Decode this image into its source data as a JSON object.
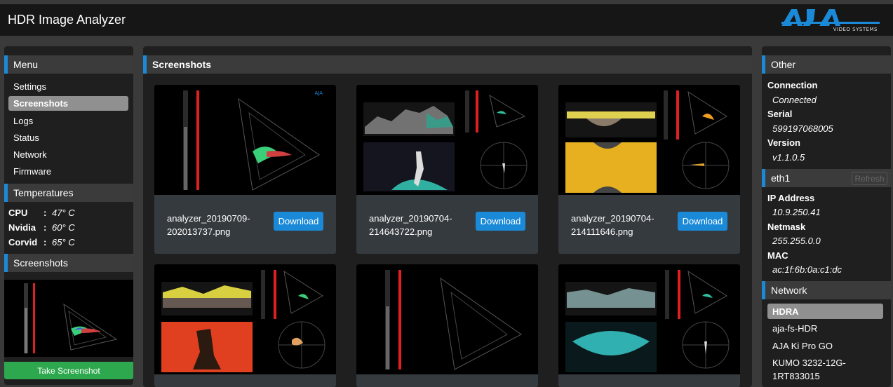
{
  "app": {
    "title": "HDR Image Analyzer",
    "logo_text": "AJA",
    "logo_subtext": "VIDEO SYSTEMS"
  },
  "menu": {
    "heading": "Menu",
    "items": [
      "Settings",
      "Screenshots",
      "Logs",
      "Status",
      "Network",
      "Firmware"
    ],
    "active": "Screenshots"
  },
  "temperatures": {
    "heading": "Temperatures",
    "rows": [
      {
        "label": "CPU",
        "sep": ":",
        "value": "47° C"
      },
      {
        "label": "Nvidia",
        "sep": ":",
        "value": "60° C"
      },
      {
        "label": "Corvid",
        "sep": ":",
        "value": "65° C"
      }
    ]
  },
  "side_screenshots": {
    "heading": "Screenshots",
    "take_label": "Take Screenshot"
  },
  "main": {
    "heading": "Screenshots",
    "download_label": "Download",
    "cards": [
      {
        "filename": "analyzer_20190709-202013737.png",
        "style": "gamut"
      },
      {
        "filename": "analyzer_20190704-214643722.png",
        "style": "dancer"
      },
      {
        "filename": "analyzer_20190704-214111646.png",
        "style": "mirror-yellow"
      },
      {
        "filename": "",
        "style": "red-figure"
      },
      {
        "filename": "",
        "style": "gamut"
      },
      {
        "filename": "",
        "style": "mirror-teal"
      }
    ]
  },
  "other": {
    "heading": "Other",
    "connection_label": "Connection",
    "connection_value": "Connected",
    "serial_label": "Serial",
    "serial_value": "599197068005",
    "version_label": "Version",
    "version_value": "v1.1.0.5"
  },
  "eth1": {
    "heading": "eth1",
    "refresh_label": "Refresh",
    "ip_label": "IP Address",
    "ip_value": "10.9.250.41",
    "netmask_label": "Netmask",
    "netmask_value": "255.255.0.0",
    "mac_label": "MAC",
    "mac_value": "ac:1f:6b:0a:c1:dc"
  },
  "network": {
    "heading": "Network",
    "items": [
      "HDRA",
      "aja-fs-HDR",
      "AJA Ki Pro GO",
      "KUMO 3232-12G-1RT833015"
    ],
    "active": "HDRA"
  },
  "colors": {
    "accent": "#1a8ad8",
    "take_button": "#2ea84e",
    "active_item": "#909090"
  }
}
